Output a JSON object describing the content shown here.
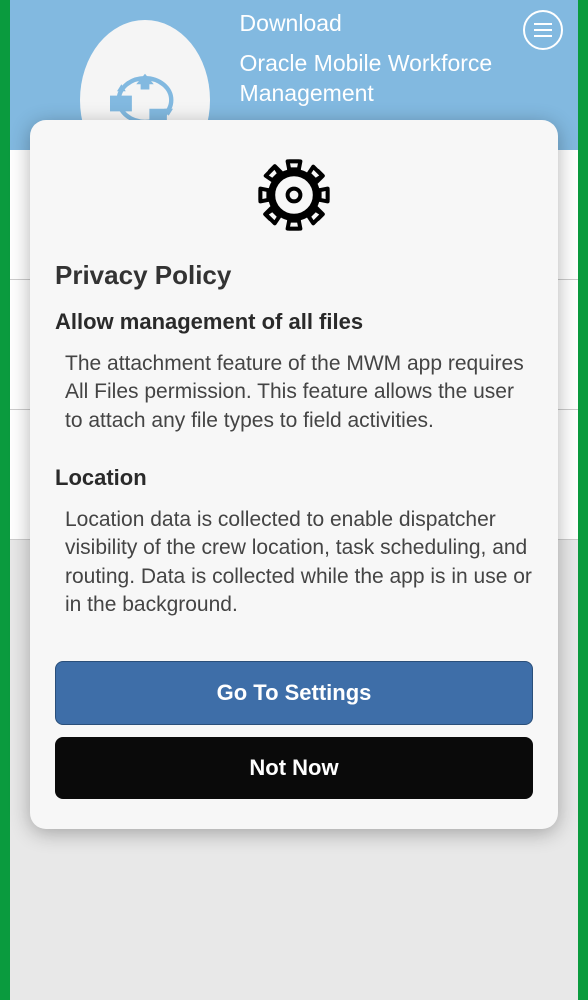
{
  "header": {
    "download_label": "Download",
    "app_title": "Oracle Mobile Workforce Management"
  },
  "dialog": {
    "title": "Privacy Policy",
    "sections": [
      {
        "heading": "Allow management of all files",
        "body": "The attachment feature of the MWM app requires All Files permission. This feature allows the user to attach any file types to field activities."
      },
      {
        "heading": "Location",
        "body": "Location data is collected to enable dispatcher visibility of the crew location, task scheduling, and routing. Data is collected while the app is in use or in the background."
      }
    ],
    "buttons": {
      "primary": "Go To Settings",
      "secondary": "Not Now"
    }
  }
}
